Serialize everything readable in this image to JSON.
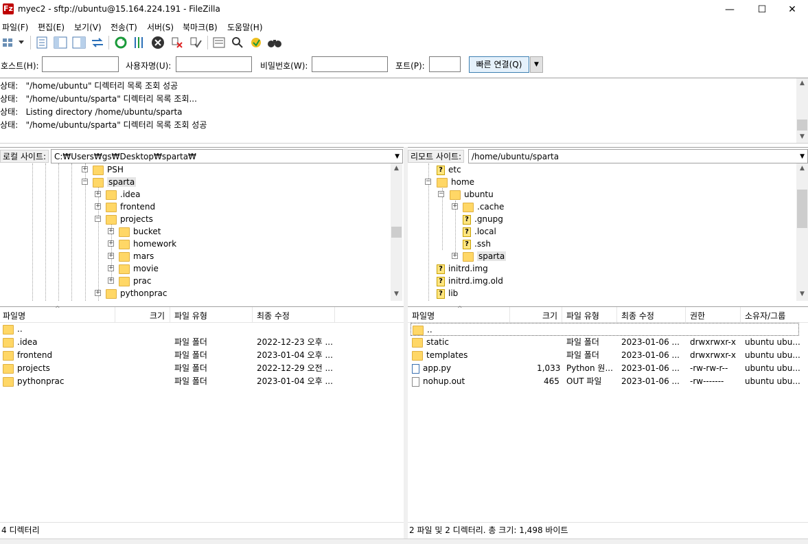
{
  "window": {
    "title": "myec2 - sftp://ubuntu@15.164.224.191 - FileZilla",
    "app_icon": "Fz",
    "minimize": "—",
    "maximize": "☐",
    "close": "✕"
  },
  "menu": [
    "파일(F)",
    "편집(E)",
    "보기(V)",
    "전송(T)",
    "서버(S)",
    "북마크(B)",
    "도움말(H)"
  ],
  "quickconnect": {
    "host_label": "호스트(H):",
    "user_label": "사용자명(U):",
    "pass_label": "비밀번호(W):",
    "port_label": "포트(P):",
    "button": "빠른 연결(Q)",
    "dropdown": "▼"
  },
  "log": [
    {
      "prefix": "상태:",
      "text": "\"/home/ubuntu\" 디렉터리 목록 조회 성공"
    },
    {
      "prefix": "상태:",
      "text": "\"/home/ubuntu/sparta\" 디렉터리 목록 조회..."
    },
    {
      "prefix": "상태:",
      "text": "Listing directory /home/ubuntu/sparta"
    },
    {
      "prefix": "상태:",
      "text": "\"/home/ubuntu/sparta\" 디렉터리 목록 조회 성공"
    }
  ],
  "local": {
    "site_label": "로컬 사이트:",
    "path": "C:₩Users₩gs₩Desktop₩sparta₩",
    "tree": [
      "PSH",
      "sparta",
      ".idea",
      "frontend",
      "projects",
      "bucket",
      "homework",
      "mars",
      "movie",
      "prac",
      "pythonprac"
    ],
    "columns": {
      "name": "파일명",
      "size": "크기",
      "type": "파일 유형",
      "modified": "최종 수정"
    },
    "files": [
      {
        "name": "..",
        "size": "",
        "type": "",
        "modified": ""
      },
      {
        "name": ".idea",
        "size": "",
        "type": "파일 폴더",
        "modified": "2022-12-23 오후 ..."
      },
      {
        "name": "frontend",
        "size": "",
        "type": "파일 폴더",
        "modified": "2023-01-04 오후 ..."
      },
      {
        "name": "projects",
        "size": "",
        "type": "파일 폴더",
        "modified": "2022-12-29 오전 ..."
      },
      {
        "name": "pythonprac",
        "size": "",
        "type": "파일 폴더",
        "modified": "2023-01-04 오후 ..."
      }
    ],
    "status": "4 디렉터리"
  },
  "remote": {
    "site_label": "리모트 사이트:",
    "path": "/home/ubuntu/sparta",
    "tree": [
      "etc",
      "home",
      "ubuntu",
      ".cache",
      ".gnupg",
      ".local",
      ".ssh",
      "sparta",
      "initrd.img",
      "initrd.img.old",
      "lib"
    ],
    "columns": {
      "name": "파일명",
      "size": "크기",
      "type": "파일 유형",
      "modified": "최종 수정",
      "perm": "권한",
      "owner": "소유자/그룹"
    },
    "files": [
      {
        "name": "..",
        "size": "",
        "type": "",
        "modified": "",
        "perm": "",
        "owner": ""
      },
      {
        "name": "static",
        "size": "",
        "type": "파일 폴더",
        "modified": "2023-01-06 ...",
        "perm": "drwxrwxr-x",
        "owner": "ubuntu ubu..."
      },
      {
        "name": "templates",
        "size": "",
        "type": "파일 폴더",
        "modified": "2023-01-06 ...",
        "perm": "drwxrwxr-x",
        "owner": "ubuntu ubu..."
      },
      {
        "name": "app.py",
        "size": "1,033",
        "type": "Python 원...",
        "modified": "2023-01-06 ...",
        "perm": "-rw-rw-r--",
        "owner": "ubuntu ubu..."
      },
      {
        "name": "nohup.out",
        "size": "465",
        "type": "OUT 파일",
        "modified": "2023-01-06 ...",
        "perm": "-rw-------",
        "owner": "ubuntu ubu..."
      }
    ],
    "status": "2 파일 및 2 디렉터리. 총 크기: 1,498 바이트"
  }
}
